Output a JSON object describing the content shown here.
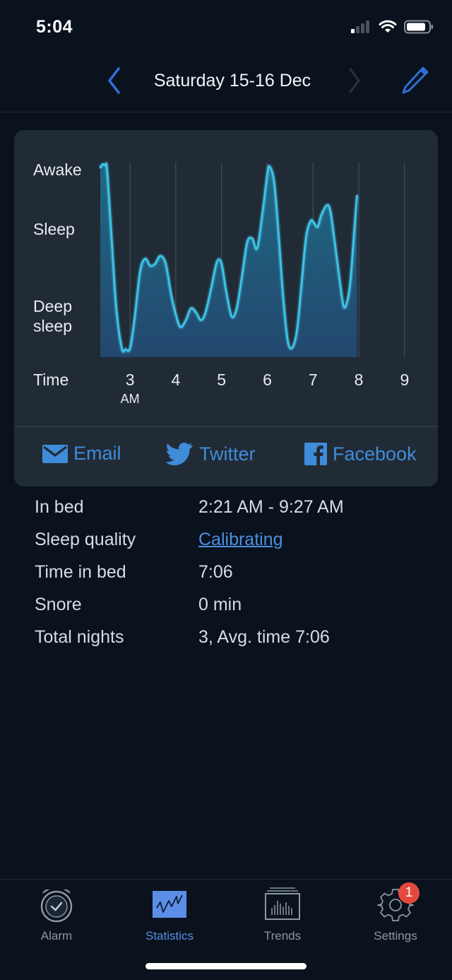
{
  "status_bar": {
    "time": "5:04",
    "icons": [
      "cellular-signal-icon",
      "wifi-icon",
      "battery-icon"
    ]
  },
  "header": {
    "title": "Saturday 15-16 Dec",
    "prev_icon": "chevron-left-icon",
    "next_icon": "chevron-right-icon",
    "edit_icon": "pencil-icon",
    "accent": "#2f6fd6"
  },
  "chart_data": {
    "type": "area",
    "title": "",
    "y_levels": [
      {
        "label": "Awake",
        "value": 96
      },
      {
        "label": "Sleep",
        "value": 66
      },
      {
        "label": "Deep\nsleep",
        "value": 21
      }
    ],
    "ylim": [
      0,
      100
    ],
    "xlabel": "Time",
    "x_ticks": [
      {
        "label": "3",
        "sub": "AM",
        "value": 3
      },
      {
        "label": "4",
        "sub": "",
        "value": 4
      },
      {
        "label": "5",
        "sub": "",
        "value": 5
      },
      {
        "label": "6",
        "sub": "",
        "value": 6
      },
      {
        "label": "7",
        "sub": "",
        "value": 7
      },
      {
        "label": "8",
        "sub": "",
        "value": 8
      },
      {
        "label": "9",
        "sub": "",
        "value": 9
      }
    ],
    "xlim": [
      2.35,
      9.45
    ],
    "grid": "vertical",
    "line_color": "#3fc3e6",
    "fill_top_color": "#1f6a84",
    "fill_bottom_color": "#23476e",
    "points": [
      [
        2.35,
        97.5
      ],
      [
        2.4,
        99
      ],
      [
        2.46,
        98.5
      ],
      [
        2.5,
        96
      ],
      [
        2.6,
        60
      ],
      [
        2.7,
        25
      ],
      [
        2.82,
        4.5
      ],
      [
        2.9,
        4
      ],
      [
        3.0,
        4.5
      ],
      [
        3.1,
        20
      ],
      [
        3.22,
        44
      ],
      [
        3.33,
        50.5
      ],
      [
        3.44,
        47
      ],
      [
        3.55,
        48
      ],
      [
        3.66,
        52
      ],
      [
        3.78,
        48
      ],
      [
        3.9,
        32
      ],
      [
        4.0,
        22
      ],
      [
        4.1,
        15.5
      ],
      [
        4.22,
        19
      ],
      [
        4.33,
        25
      ],
      [
        4.44,
        23
      ],
      [
        4.55,
        19
      ],
      [
        4.65,
        23
      ],
      [
        4.78,
        36
      ],
      [
        4.9,
        49
      ],
      [
        5.0,
        48
      ],
      [
        5.1,
        34
      ],
      [
        5.22,
        21
      ],
      [
        5.33,
        25
      ],
      [
        5.45,
        42
      ],
      [
        5.56,
        59
      ],
      [
        5.67,
        61
      ],
      [
        5.78,
        56
      ],
      [
        5.9,
        75
      ],
      [
        6.0,
        94
      ],
      [
        6.05,
        98
      ],
      [
        6.15,
        90
      ],
      [
        6.25,
        62
      ],
      [
        6.35,
        30
      ],
      [
        6.45,
        8
      ],
      [
        6.55,
        5
      ],
      [
        6.65,
        14
      ],
      [
        6.75,
        38
      ],
      [
        6.85,
        62
      ],
      [
        6.95,
        70
      ],
      [
        7.02,
        69
      ],
      [
        7.1,
        67
      ],
      [
        7.18,
        73
      ],
      [
        7.3,
        78
      ],
      [
        7.38,
        75
      ],
      [
        7.48,
        58
      ],
      [
        7.58,
        40
      ],
      [
        7.67,
        26
      ],
      [
        7.75,
        29
      ],
      [
        7.82,
        40
      ],
      [
        7.9,
        65
      ],
      [
        7.96,
        83
      ]
    ]
  },
  "share": {
    "email_label": "Email",
    "twitter_label": "Twitter",
    "facebook_label": "Facebook",
    "email_icon": "envelope-icon",
    "twitter_icon": "twitter-bird-icon",
    "facebook_icon": "facebook-icon",
    "color": "#3f8cdb"
  },
  "stats": [
    {
      "label": "In bed",
      "value": "2:21 AM - 9:27 AM",
      "link": false
    },
    {
      "label": "Sleep quality",
      "value": "Calibrating",
      "link": true
    },
    {
      "label": "Time in bed",
      "value": "7:06",
      "link": false
    },
    {
      "label": "Snore",
      "value": "0 min",
      "link": false
    },
    {
      "label": "Total nights",
      "value": "3, Avg. time 7:06",
      "link": false
    }
  ],
  "tabs": [
    {
      "label": "Alarm",
      "icon": "alarm-clock-icon",
      "active": false
    },
    {
      "label": "Statistics",
      "icon": "statistics-chart-icon",
      "active": true
    },
    {
      "label": "Trends",
      "icon": "trends-bars-icon",
      "active": false
    },
    {
      "label": "Settings",
      "icon": "gear-icon",
      "active": false,
      "badge": "1"
    }
  ]
}
